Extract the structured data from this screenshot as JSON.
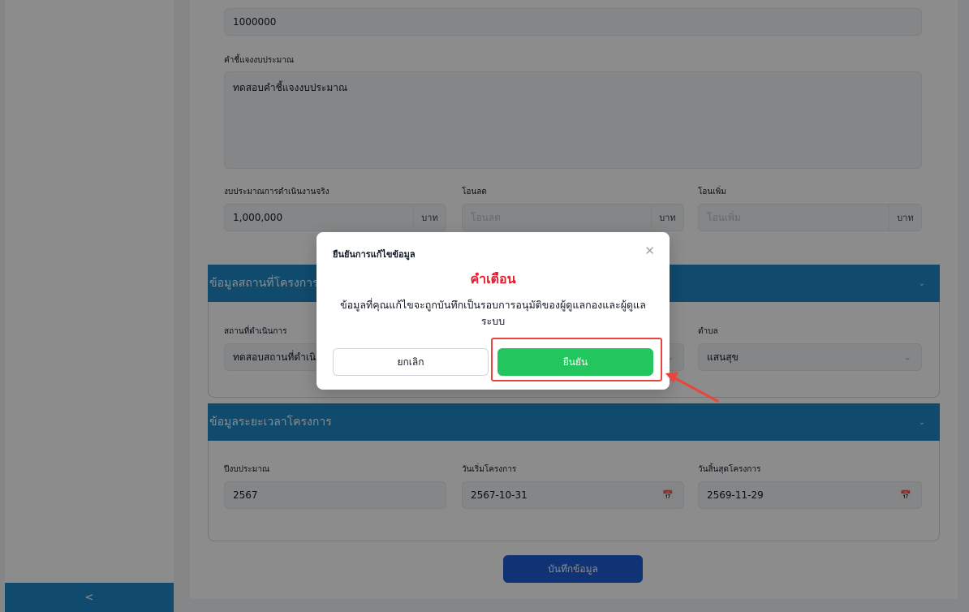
{
  "sidebar": {
    "collapse_icon": "chevron-left-icon",
    "collapse_glyph": "<"
  },
  "form": {
    "budget_value": "1000000",
    "budget_explanation_label": "คำชี้แจงงบประมาณ",
    "budget_explanation_value": "ทดสอบคำชี้แจงงบประมาณ",
    "actual_budget_label": "งบประมาณการดำเนินงานจริง",
    "actual_budget_value": "1,000,000",
    "currency_unit": "บาท",
    "transfer_out_label": "โอนลด",
    "transfer_out_placeholder": "โอนลด",
    "transfer_in_label": "โอนเพิ่ม",
    "transfer_in_placeholder": "โอนเพิ่ม"
  },
  "location_section": {
    "title": "ข้อมูลสถานที่โครงการ",
    "place_label": "สถานที่ดำเนินการ",
    "place_value": "ทดสอบสถานที่ดำเนิ",
    "subdistrict_label": "ตำบล",
    "subdistrict_value": "แสนสุข"
  },
  "period_section": {
    "title": "ข้อมูลระยะเวลาโครงการ",
    "fiscal_year_label": "ปีงบประมาณ",
    "fiscal_year_value": "2567",
    "start_date_label": "วันเริ่มโครงการ",
    "start_date_value": "2567-10-31",
    "end_date_label": "วันสิ้นสุดโครงการ",
    "end_date_value": "2569-11-29"
  },
  "save_button_label": "บันทึกข้อมูล",
  "modal": {
    "title": "ยืนยันการแก้ไขข้อมูล",
    "warning": "คำเตือน",
    "message": "ข้อมูลที่คุณแก้ไขจะถูกบันทึกเป็นรอบการอนุมัติของผู้ดูแลกองและผู้ดูแลระบบ",
    "cancel_label": "ยกเลิก",
    "confirm_label": "ยืนยัน"
  },
  "colors": {
    "section_header": "#1e88c7",
    "save_button": "#1d5dd6",
    "confirm_button": "#22c55e",
    "warning_text": "#e11d2e",
    "highlight": "#e8453c"
  }
}
